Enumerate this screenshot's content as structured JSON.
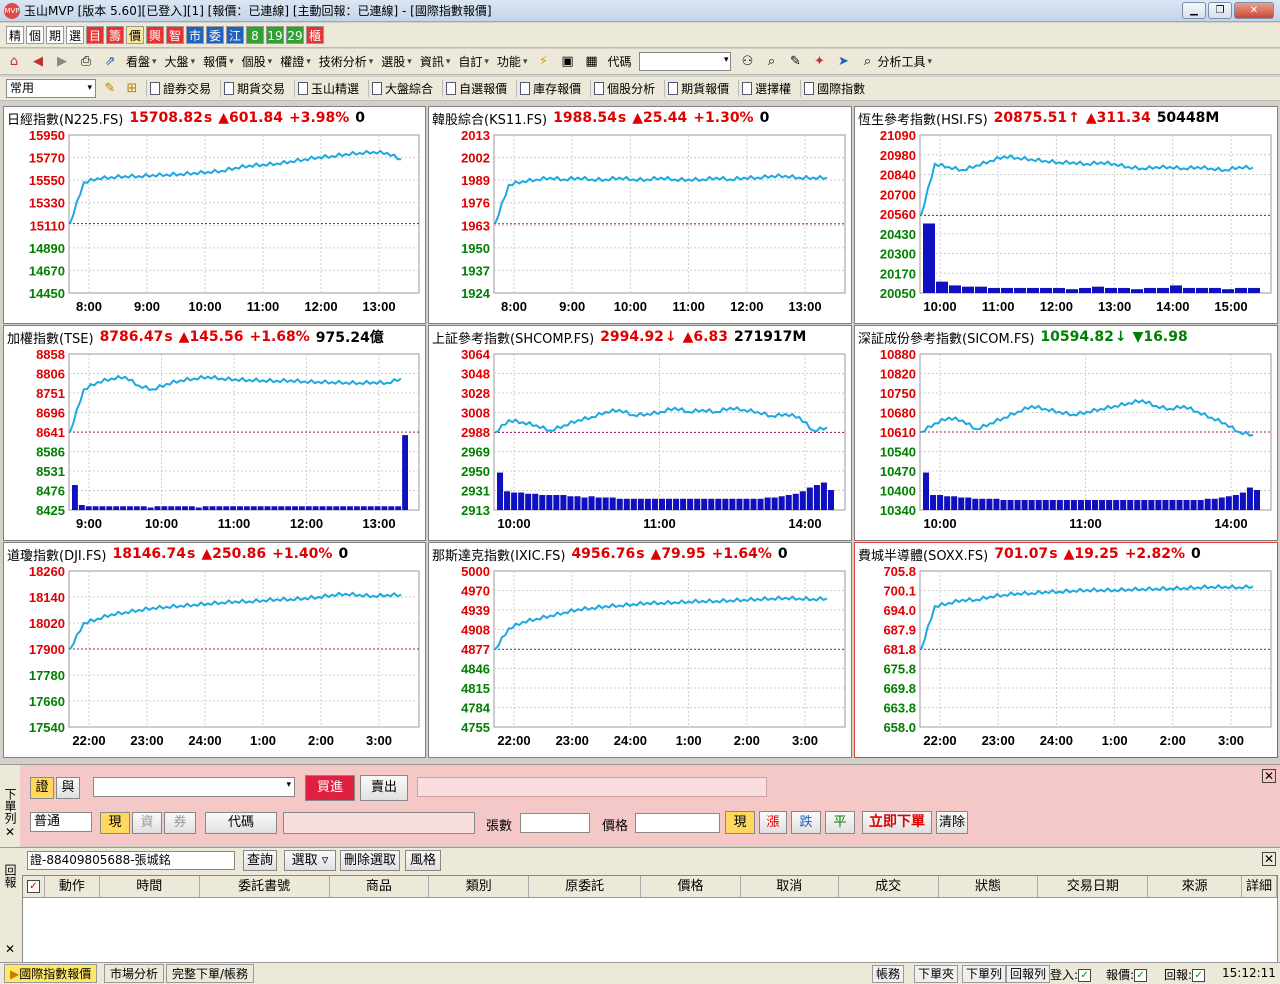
{
  "window": {
    "title": "玉山MVP [版本 5.60][已登入][1] [報價：已連線] [主動回報：已連線] - [國際指數報價]"
  },
  "toolbar1": {
    "buttons": [
      "精",
      "個",
      "期",
      "選",
      "目",
      "籌",
      "價",
      "興",
      "智",
      "市",
      "委",
      "江",
      "8",
      "19",
      "29",
      "櫃"
    ]
  },
  "toolbar2": {
    "menus": [
      "看盤",
      "大盤",
      "報價",
      "個股",
      "權證",
      "技術分析",
      "選股",
      "資訊",
      "自訂",
      "功能"
    ],
    "code_label": "代碼",
    "analysis_label": "分析工具"
  },
  "toolbar3": {
    "preset": "常用",
    "links": [
      "證券交易",
      "期貨交易",
      "玉山精選",
      "大盤綜合",
      "自選報價",
      "庫存報價",
      "個股分析",
      "期貨報價",
      "選擇權",
      "國際指數"
    ]
  },
  "panels": [
    {
      "name": "日經指數(N225.FS)",
      "price": "15708.82",
      "flag": "s",
      "change": "▲601.84",
      "pct": "+3.98%",
      "vol": "0",
      "ticks": [
        "15950",
        "15770",
        "15550",
        "15330",
        "15110",
        "14890",
        "14670",
        "14450"
      ],
      "xticks": [
        "8:00",
        "9:00",
        "10:00",
        "11:00",
        "12:00",
        "13:00"
      ],
      "refIndex": 4,
      "series": [
        15110,
        15500,
        15540,
        15550,
        15560,
        15560,
        15570,
        15575,
        15580,
        15590,
        15600,
        15610,
        15640,
        15660,
        15670,
        15680,
        15700,
        15720,
        15740,
        15750,
        15770,
        15780,
        15790,
        15780,
        15720
      ],
      "vols": []
    },
    {
      "name": "韓股綜合(KS11.FS)",
      "price": "1988.54",
      "flag": "s",
      "change": "▲25.44",
      "pct": "+1.30%",
      "vol": "0",
      "ticks": [
        "2013",
        "2002",
        "1989",
        "1976",
        "1963",
        "1950",
        "1937",
        "1924"
      ],
      "xticks": [
        "8:00",
        "9:00",
        "10:00",
        "11:00",
        "12:00",
        "13:00"
      ],
      "refIndex": 4,
      "series": [
        1963,
        1985,
        1987,
        1988,
        1989,
        1988,
        1989,
        1988,
        1988,
        1989,
        1988,
        1988,
        1989,
        1988,
        1988,
        1988,
        1989,
        1988,
        1989,
        1989,
        1990,
        1990,
        1989,
        1989,
        1989
      ],
      "vols": []
    },
    {
      "name": "恆生參考指數(HSI.FS)",
      "price": "20875.51",
      "flag": "↑",
      "change": "▲311.34",
      "pct": "",
      "vol": "50448M",
      "ticks": [
        "21090",
        "20980",
        "20840",
        "20700",
        "20560",
        "20430",
        "20300",
        "20170",
        "20050"
      ],
      "xticks": [
        "10:00",
        "11:00",
        "12:00",
        "13:00",
        "14:00",
        "15:00"
      ],
      "refIndex": 4,
      "series": [
        20560,
        20900,
        20880,
        20860,
        20890,
        20920,
        20950,
        20940,
        20930,
        20920,
        20910,
        20910,
        20900,
        20910,
        20900,
        20880,
        20870,
        20880,
        20880,
        20870,
        20880,
        20870,
        20860,
        20880,
        20875
      ],
      "vols": [
        55,
        9,
        6,
        5,
        5,
        4,
        4,
        4,
        4,
        4,
        4,
        3,
        4,
        5,
        4,
        4,
        3,
        4,
        4,
        6,
        4,
        4,
        4,
        3,
        4,
        4
      ]
    },
    {
      "name": "加權指數(TSE)",
      "price": "8786.47",
      "flag": "s",
      "change": "▲145.56",
      "pct": "+1.68%",
      "vol": "975.24億",
      "ticks": [
        "8858",
        "8806",
        "8751",
        "8696",
        "8641",
        "8586",
        "8531",
        "8476",
        "8425"
      ],
      "xticks": [
        "9:00",
        "10:00",
        "11:00",
        "12:00",
        "13:00"
      ],
      "refIndex": 4,
      "series": [
        8641,
        8760,
        8780,
        8790,
        8795,
        8770,
        8760,
        8775,
        8785,
        8790,
        8795,
        8790,
        8788,
        8786,
        8785,
        8784,
        8785,
        8782,
        8781,
        8780,
        8779,
        8778,
        8780,
        8778,
        8790
      ],
      "vols": [
        20,
        4,
        3,
        3,
        3,
        3,
        3,
        3,
        3,
        3,
        3,
        2,
        3,
        3,
        3,
        3,
        3,
        3,
        2,
        3,
        3,
        3,
        3,
        3,
        3,
        3,
        3,
        3,
        3,
        3,
        3,
        3,
        3,
        3,
        3,
        3,
        3,
        3,
        3,
        3,
        3,
        3,
        3,
        3,
        3,
        3,
        3,
        3,
        60
      ]
    },
    {
      "name": "上証參考指數(SHCOMP.FS)",
      "price": "2994.92",
      "flag": "↓",
      "change": "▲6.83",
      "pct": "",
      "vol": "271917M",
      "ticks": [
        "3064",
        "3048",
        "3028",
        "3008",
        "2988",
        "2969",
        "2950",
        "2931",
        "2913"
      ],
      "xticks": [
        "10:00",
        "11:00",
        "14:00"
      ],
      "refIndex": 4,
      "series": [
        2988,
        3000,
        2998,
        2995,
        2990,
        2995,
        3000,
        3003,
        3008,
        3010,
        3005,
        3006,
        3008,
        3012,
        3008,
        3010,
        3008,
        3012,
        3010,
        3008,
        3004,
        3006,
        3003,
        2990,
        2993
      ],
      "vols": [
        30,
        15,
        14,
        14,
        13,
        13,
        12,
        12,
        12,
        12,
        11,
        11,
        10,
        11,
        10,
        10,
        10,
        9,
        9,
        9,
        9,
        9,
        9,
        9,
        9,
        9,
        9,
        9,
        9,
        9,
        9,
        9,
        9,
        9,
        9,
        9,
        9,
        9,
        10,
        10,
        11,
        12,
        13,
        15,
        18,
        20,
        22,
        16
      ]
    },
    {
      "name": "深証成份參考指數(SICOM.FS)",
      "price": "10594.82",
      "flag": "↓",
      "change": "▼16.98",
      "pct": "",
      "vol": "",
      "ticks": [
        "10880",
        "10820",
        "10750",
        "10680",
        "10610",
        "10540",
        "10470",
        "10400",
        "10340"
      ],
      "xticks": [
        "10:00",
        "11:00",
        "14:00"
      ],
      "refIndex": 4,
      "series": [
        10610,
        10640,
        10660,
        10650,
        10620,
        10640,
        10660,
        10680,
        10700,
        10690,
        10680,
        10670,
        10680,
        10690,
        10700,
        10710,
        10720,
        10700,
        10690,
        10700,
        10680,
        10660,
        10640,
        10610,
        10600
      ],
      "vols": [
        30,
        12,
        12,
        11,
        11,
        10,
        10,
        9,
        9,
        9,
        9,
        8,
        8,
        8,
        8,
        8,
        8,
        8,
        8,
        8,
        8,
        8,
        8,
        8,
        8,
        8,
        8,
        8,
        8,
        8,
        8,
        8,
        8,
        8,
        8,
        8,
        8,
        8,
        8,
        8,
        9,
        9,
        10,
        11,
        12,
        14,
        18,
        16
      ]
    },
    {
      "name": "道瓊指數(DJI.FS)",
      "price": "18146.74",
      "flag": "s",
      "change": "▲250.86",
      "pct": "+1.40%",
      "vol": "0",
      "ticks": [
        "18260",
        "18140",
        "18020",
        "17900",
        "17780",
        "17660",
        "17540"
      ],
      "xticks": [
        "22:00",
        "23:00",
        "24:00",
        "1:00",
        "2:00",
        "3:00"
      ],
      "refIndex": 3,
      "series": [
        17900,
        18020,
        18040,
        18060,
        18070,
        18080,
        18090,
        18095,
        18100,
        18105,
        18110,
        18115,
        18120,
        18120,
        18125,
        18130,
        18130,
        18135,
        18140,
        18150,
        18155,
        18150,
        18145,
        18150,
        18150
      ],
      "vols": []
    },
    {
      "name": "那斯達克指數(IXIC.FS)",
      "price": "4956.76",
      "flag": "s",
      "change": "▲79.95",
      "pct": "+1.64%",
      "vol": "0",
      "ticks": [
        "5000",
        "4970",
        "4939",
        "4908",
        "4877",
        "4846",
        "4815",
        "4784",
        "4755"
      ],
      "xticks": [
        "22:00",
        "23:00",
        "24:00",
        "1:00",
        "2:00",
        "3:00"
      ],
      "refIndex": 4,
      "series": [
        4877,
        4910,
        4920,
        4925,
        4930,
        4935,
        4940,
        4942,
        4945,
        4946,
        4948,
        4950,
        4950,
        4951,
        4952,
        4953,
        4953,
        4954,
        4955,
        4956,
        4957,
        4958,
        4957,
        4956,
        4957
      ],
      "vols": []
    },
    {
      "name": "費城半導體(SOXX.FS)",
      "price": "701.07",
      "flag": "s",
      "change": "▲19.25",
      "pct": "+2.82%",
      "vol": "0",
      "ticks": [
        "705.8",
        "700.1",
        "694.0",
        "687.9",
        "681.8",
        "675.8",
        "669.8",
        "663.8",
        "658.0"
      ],
      "xticks": [
        "22:00",
        "23:00",
        "24:00",
        "1:00",
        "2:00",
        "3:00"
      ],
      "refIndex": 4,
      "series": [
        681.8,
        695,
        696,
        697,
        697,
        698,
        698.5,
        699,
        699,
        699.5,
        699.5,
        699.8,
        700,
        700,
        700,
        700.2,
        700.3,
        700.4,
        700.5,
        700.6,
        700.8,
        701,
        701,
        700.8,
        701.07
      ],
      "vols": []
    }
  ],
  "order": {
    "side_label": "下單列",
    "sec_btn": "證",
    "margin_btn": "與",
    "buy": "買進",
    "sell": "賣出",
    "type": "普通",
    "cash": "現",
    "fund": "資",
    "coupon": "券",
    "code_btn": "代碼",
    "qty_label": "張數",
    "price_label": "價格",
    "now": "現",
    "up": "漲",
    "down": "跌",
    "flat": "平",
    "submit": "立即下單",
    "clear": "清除"
  },
  "report": {
    "side_label": "回報",
    "account": "證-88409805688-張城銘",
    "query": "查詢",
    "select": "選取 ▿",
    "unselect": "刪除選取",
    "style": "風格",
    "columns": [
      "動作",
      "時間",
      "委託書號",
      "商品",
      "類別",
      "原委託",
      "價格",
      "取消",
      "成交",
      "狀態",
      "交易日期",
      "來源",
      "詳細"
    ]
  },
  "status": {
    "tabs": [
      "國際指數報價",
      "市場分析",
      "完整下單/帳務"
    ],
    "buttons": [
      "帳務",
      "下單夾",
      "下單列",
      "回報列"
    ],
    "login": "登入:",
    "quote": "報價:",
    "report": "回報:",
    "clock": "15:12:11"
  },
  "colors": {
    "line": "#1ea8e0",
    "vol": "#1010c0",
    "ref": "#a0206a",
    "up": "#e00000",
    "down": "#008000"
  }
}
